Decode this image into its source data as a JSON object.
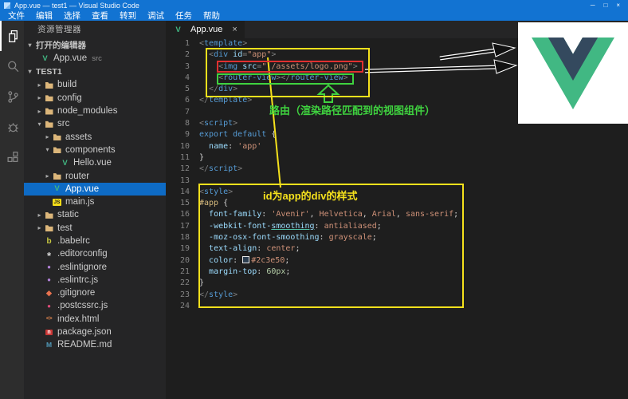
{
  "title_bar": {
    "title": "App.vue — test1 — Visual Studio Code",
    "menus": [
      "文件",
      "编辑",
      "选择",
      "查看",
      "转到",
      "调试",
      "任务",
      "帮助"
    ],
    "window_controls": {
      "minimize": "─",
      "maximize": "□",
      "close": "×"
    }
  },
  "activity_bar": {
    "items": [
      {
        "name": "explorer-icon",
        "active": true
      },
      {
        "name": "search-icon",
        "active": false
      },
      {
        "name": "source-control-icon",
        "active": false
      },
      {
        "name": "debug-icon",
        "active": false
      },
      {
        "name": "extensions-icon",
        "active": false
      }
    ]
  },
  "sidebar": {
    "header": "资源管理器",
    "sections": {
      "open_editors_label": "打开的编辑器",
      "root_label": "TEST1"
    },
    "open_editors": [
      {
        "label": "App.vue",
        "detail": "src",
        "icon": "vue"
      }
    ],
    "tree": [
      {
        "label": "build",
        "icon": "folder",
        "indent": 1,
        "expand": "closed"
      },
      {
        "label": "config",
        "icon": "folder",
        "indent": 1,
        "expand": "closed"
      },
      {
        "label": "node_modules",
        "icon": "folder",
        "indent": 1,
        "expand": "closed"
      },
      {
        "label": "src",
        "icon": "folder",
        "indent": 1,
        "expand": "open"
      },
      {
        "label": "assets",
        "icon": "folder",
        "indent": 2,
        "expand": "closed"
      },
      {
        "label": "components",
        "icon": "folder",
        "indent": 2,
        "expand": "open"
      },
      {
        "label": "Hello.vue",
        "icon": "vue",
        "indent": 3
      },
      {
        "label": "router",
        "icon": "folder",
        "indent": 2,
        "expand": "closed"
      },
      {
        "label": "App.vue",
        "icon": "vue",
        "indent": 2,
        "selected": true
      },
      {
        "label": "main.js",
        "icon": "js",
        "indent": 2
      },
      {
        "label": "static",
        "icon": "folder",
        "indent": 1,
        "expand": "closed"
      },
      {
        "label": "test",
        "icon": "folder",
        "indent": 1,
        "expand": "closed"
      },
      {
        "label": ".babelrc",
        "icon": "babel",
        "indent": 1
      },
      {
        "label": ".editorconfig",
        "icon": "editorconfig",
        "indent": 1
      },
      {
        "label": ".eslintignore",
        "icon": "eslint",
        "indent": 1
      },
      {
        "label": ".eslintrc.js",
        "icon": "eslint",
        "indent": 1
      },
      {
        "label": ".gitignore",
        "icon": "git",
        "indent": 1
      },
      {
        "label": ".postcssrc.js",
        "icon": "postcss",
        "indent": 1
      },
      {
        "label": "index.html",
        "icon": "html",
        "indent": 1
      },
      {
        "label": "package.json",
        "icon": "npm",
        "indent": 1
      },
      {
        "label": "README.md",
        "icon": "md",
        "indent": 1
      }
    ]
  },
  "editor": {
    "tab": {
      "label": "App.vue",
      "icon": "vue",
      "close": "×"
    },
    "lines": [
      [
        [
          "p",
          "<"
        ],
        [
          "tag",
          "template"
        ],
        [
          "p",
          ">"
        ]
      ],
      [
        [
          "w",
          "  "
        ],
        [
          "p",
          "<"
        ],
        [
          "tag",
          "div"
        ],
        [
          "w",
          " "
        ],
        [
          "attr",
          "id"
        ],
        [
          "p",
          "="
        ],
        [
          "str",
          "\"app\""
        ],
        [
          "p",
          ">"
        ]
      ],
      [
        [
          "w",
          "    "
        ],
        [
          "p",
          "<"
        ],
        [
          "tag",
          "img"
        ],
        [
          "w",
          " "
        ],
        [
          "attr",
          "src"
        ],
        [
          "p",
          "="
        ],
        [
          "str",
          "\"./assets/logo.png\""
        ],
        [
          "p",
          ">"
        ]
      ],
      [
        [
          "w",
          "    "
        ],
        [
          "p",
          "<"
        ],
        [
          "tag",
          "router-view"
        ],
        [
          "p",
          "></"
        ],
        [
          "tag",
          "router-view"
        ],
        [
          "p",
          ">"
        ]
      ],
      [
        [
          "w",
          "  "
        ],
        [
          "p",
          "</"
        ],
        [
          "tag",
          "div"
        ],
        [
          "p",
          ">"
        ]
      ],
      [
        [
          "p",
          "</"
        ],
        [
          "tag",
          "template"
        ],
        [
          "p",
          ">"
        ]
      ],
      [],
      [
        [
          "p",
          "<"
        ],
        [
          "tag",
          "script"
        ],
        [
          "p",
          ">"
        ]
      ],
      [
        [
          "kw",
          "export"
        ],
        [
          "w",
          " "
        ],
        [
          "kw",
          "default"
        ],
        [
          "w",
          " "
        ],
        [
          "txt",
          "{"
        ]
      ],
      [
        [
          "w",
          "  "
        ],
        [
          "attr",
          "name"
        ],
        [
          "txt",
          ": "
        ],
        [
          "str",
          "'app'"
        ]
      ],
      [
        [
          "txt",
          "}"
        ]
      ],
      [
        [
          "p",
          "</"
        ],
        [
          "tag",
          "script"
        ],
        [
          "p",
          ">"
        ]
      ],
      [],
      [
        [
          "p",
          "<"
        ],
        [
          "tag",
          "style"
        ],
        [
          "p",
          ">"
        ]
      ],
      [
        [
          "sel",
          "#app"
        ],
        [
          "txt",
          " {"
        ]
      ],
      [
        [
          "w",
          "  "
        ],
        [
          "attr",
          "font-family"
        ],
        [
          "txt",
          ": "
        ],
        [
          "str",
          "'Avenir'"
        ],
        [
          "txt",
          ", "
        ],
        [
          "val",
          "Helvetica"
        ],
        [
          "txt",
          ", "
        ],
        [
          "val",
          "Arial"
        ],
        [
          "txt",
          ", "
        ],
        [
          "val",
          "sans-serif"
        ],
        [
          "txt",
          ";"
        ]
      ],
      [
        [
          "w",
          "  "
        ],
        [
          "attr",
          "-webkit-font-"
        ],
        [
          "attru",
          "smoothing"
        ],
        [
          "txt",
          ": "
        ],
        [
          "val",
          "antialiased"
        ],
        [
          "txt",
          ";"
        ]
      ],
      [
        [
          "w",
          "  "
        ],
        [
          "attr",
          "-moz-osx-font-smoothing"
        ],
        [
          "txt",
          ": "
        ],
        [
          "val",
          "grayscale"
        ],
        [
          "txt",
          ";"
        ]
      ],
      [
        [
          "w",
          "  "
        ],
        [
          "attr",
          "text-align"
        ],
        [
          "txt",
          ": "
        ],
        [
          "val",
          "center"
        ],
        [
          "txt",
          ";"
        ]
      ],
      [
        [
          "w",
          "  "
        ],
        [
          "attr",
          "color"
        ],
        [
          "txt",
          ": "
        ],
        [
          "swatch",
          "#2c3e50"
        ],
        [
          "val",
          "#2c3e50"
        ],
        [
          "txt",
          ";"
        ]
      ],
      [
        [
          "w",
          "  "
        ],
        [
          "attr",
          "margin-top"
        ],
        [
          "txt",
          ": "
        ],
        [
          "num",
          "60px"
        ],
        [
          "txt",
          ";"
        ]
      ],
      [
        [
          "txt",
          "}"
        ]
      ],
      [
        [
          "p",
          "</"
        ],
        [
          "tag",
          "style"
        ],
        [
          "p",
          ">"
        ]
      ],
      []
    ]
  },
  "annotations": {
    "route_note": "路由（渲染路径匹配到的视图组件）",
    "style_note": "id为app的div的样式"
  },
  "colors": {
    "accent_title": "#1273d2",
    "selection_blue": "#0e6bc5",
    "annotation_yellow": "#f5e11c",
    "annotation_green": "#3fd23f",
    "annotation_red": "#e03030",
    "vue_green": "#41b883",
    "vue_dark": "#34495e"
  }
}
